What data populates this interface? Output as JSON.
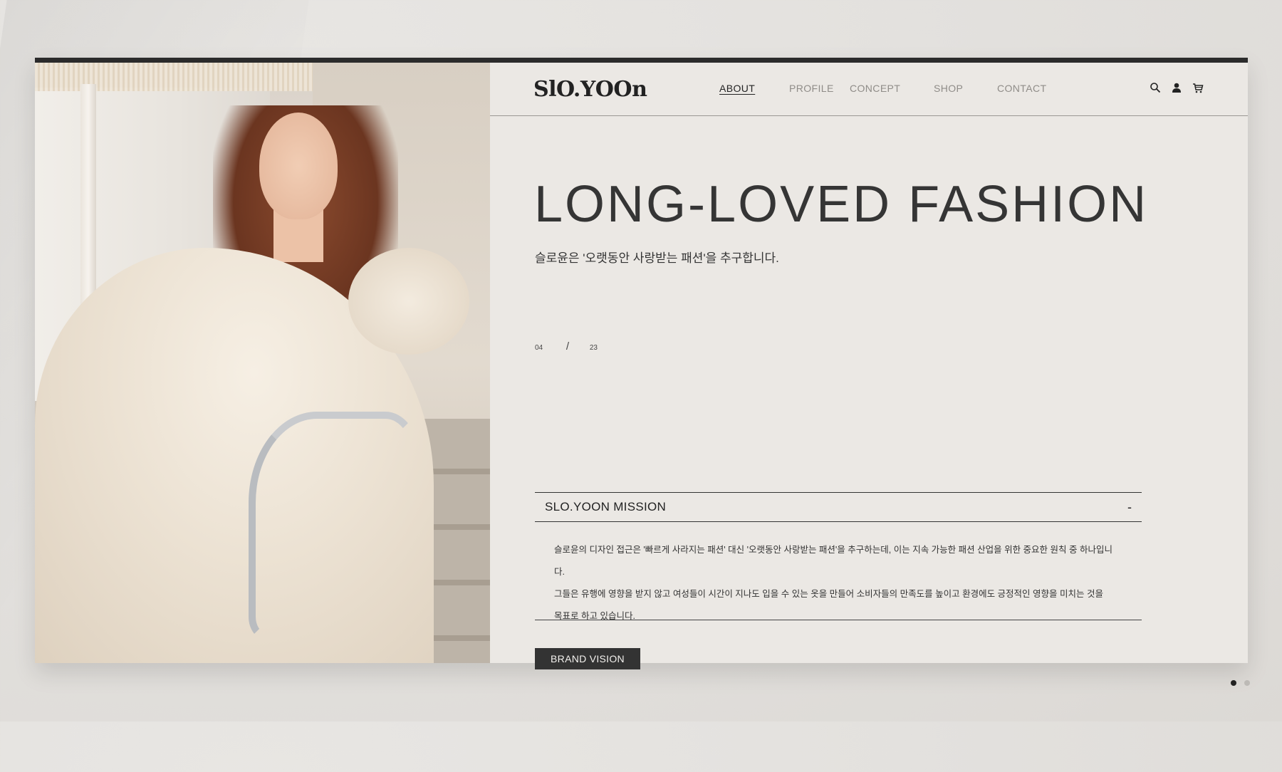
{
  "brand": {
    "logo": "SlO.YOOn"
  },
  "nav": {
    "items": [
      {
        "label": "ABOUT",
        "active": true
      },
      {
        "label": "PROFILE",
        "active": false
      },
      {
        "label": "CONCEPT",
        "active": false
      },
      {
        "label": "SHOP",
        "active": false
      },
      {
        "label": "CONTACT",
        "active": false
      }
    ],
    "icons": [
      "search-icon",
      "user-icon",
      "cart-icon"
    ]
  },
  "hero": {
    "headline": "LONG-LOVED FASHION",
    "subline": "슬로윤은 '오랫동안 사랑받는 패션'을 추구합니다."
  },
  "counter": {
    "current": "04",
    "separator": "/",
    "total": "23"
  },
  "mission": {
    "title": "SLO.YOON MISSION",
    "toggle": "-",
    "lines": [
      "슬로윤의 디자인 접근은 '빠르게 사라지는 패션' 대신 '오랫동안 사랑받는 패션'을 추구하는데, 이는 지속 가능한 패션 산업을 위한 중요한 원칙 중 하나입니다.",
      "그들은 유행에 영향을 받지 않고 여성들이 시간이 지나도 입을 수 있는 옷을 만들어 소비자들의 만족도를 높이고 환경에도 긍정적인 영향을 미치는 것을",
      "목표로 하고 있습니다."
    ]
  },
  "cta": {
    "label": "BRAND VISION"
  },
  "pagination": {
    "count": 2,
    "active_index": 0
  },
  "colors": {
    "frame_bg": "#ebe8e4",
    "accent_dark": "#2b2b2b",
    "text": "#353535",
    "muted": "#8f8c88"
  }
}
